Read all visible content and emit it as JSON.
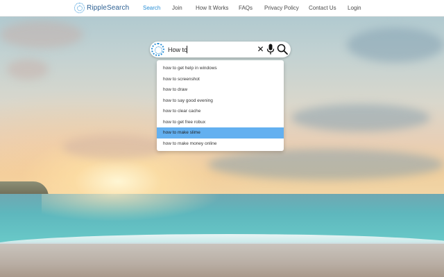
{
  "navbar": {
    "brand": "RippleSearch",
    "links": [
      {
        "label": "Search",
        "active": true
      },
      {
        "label": "Join",
        "active": false
      },
      {
        "label": "How It Works",
        "active": false
      },
      {
        "label": "FAQs",
        "active": false
      },
      {
        "label": "Privacy Policy",
        "active": false
      },
      {
        "label": "Contact Us",
        "active": false
      },
      {
        "label": "Login",
        "active": false
      }
    ]
  },
  "search": {
    "value": "How to",
    "icons": [
      "ripplesearch-logo-icon",
      "close-icon",
      "microphone-icon",
      "search-icon"
    ]
  },
  "suggestions": {
    "selected_index": 6,
    "items": [
      "how to get help in windows",
      "how to screenshot",
      "how to draw",
      "how to say good evening",
      "how to clear cache",
      "how to get free robux",
      "how to make slime",
      "how to make money online"
    ]
  },
  "colors": {
    "accent": "#2a8fd6",
    "selected_row": "#63b0f0",
    "nav_text": "#4a4a4a"
  }
}
